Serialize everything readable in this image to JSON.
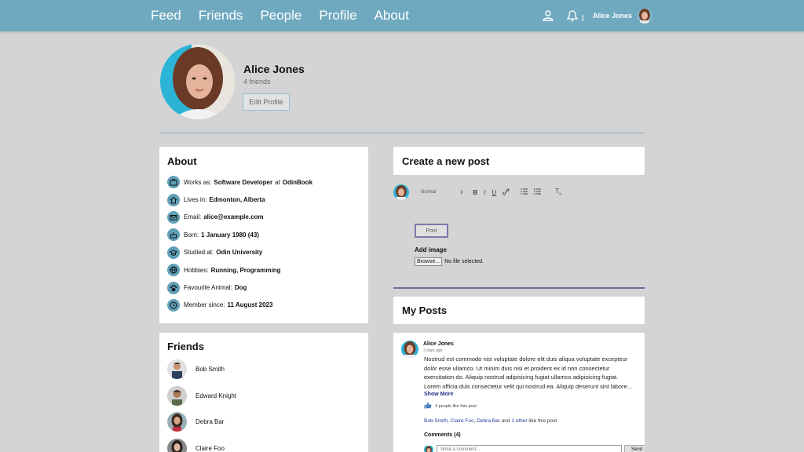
{
  "nav": {
    "links": [
      "Feed",
      "Friends",
      "People",
      "Profile",
      "About"
    ],
    "notification_count": "1",
    "user_name": "Alice Jones"
  },
  "profile": {
    "name": "Alice Jones",
    "friends_count": "4 friends",
    "edit_label": "Edit Profile"
  },
  "about": {
    "title": "About",
    "rows": [
      {
        "icon": "briefcase-icon",
        "label": "Works as:",
        "value": "Software Developer",
        "mid": "at",
        "value2": "OdinBook"
      },
      {
        "icon": "home-icon",
        "label": "Lives in:",
        "value": "Edmonton, Alberta"
      },
      {
        "icon": "email-icon",
        "label": "Email:",
        "value": "alice@example.com"
      },
      {
        "icon": "birthday-cake-icon",
        "label": "Born:",
        "value": "1 January 1980 (43)"
      },
      {
        "icon": "graduation-cap-icon",
        "label": "Studied at:",
        "value": "Odin University"
      },
      {
        "icon": "globe-icon",
        "label": "Hobbies:",
        "value": "Running, Programming"
      },
      {
        "icon": "paw-icon",
        "label": "Favourite Animal:",
        "value": "Dog"
      },
      {
        "icon": "clock-icon",
        "label": "Member since:",
        "value": "11 August 2023"
      }
    ]
  },
  "friends": {
    "title": "Friends",
    "items": [
      "Bob Smith",
      "Edward Knight",
      "Debra Bar",
      "Claire Foo"
    ]
  },
  "create_post": {
    "title": "Create a new post",
    "format_label": "Normal",
    "post_label": "Post",
    "add_image_label": "Add image",
    "browse_label": "Browse...",
    "file_status": "No file selected."
  },
  "my_posts": {
    "title": "My Posts",
    "post": {
      "author": "Alice Jones",
      "time": "2 days ago",
      "body": "Nostrud est commodo nisi voluptate dolore elit duis aliqua voluptate excepteur dolor esse ullamco. Ut minim duis nisi et proident ex id non consectetur exercitation do. Aliquip nostrud adipisicing fugiat ullamco adipisicing fugiat. Lorem officia duis consectetur velit qui nostrud ea. Aliquip deserunt sint labore...",
      "show_more": "Show More",
      "likes_text": "4 people like this post",
      "likers": [
        "Bob Smith",
        "Claire Foo",
        "Debra Bar"
      ],
      "likers_tail_and": "and",
      "likers_other": "1 other",
      "likers_tail": "like this post",
      "comments_label": "Comments (4)",
      "comment_placeholder": "Write a comment...",
      "send_label": "Send"
    }
  },
  "colors": {
    "nav_bg": "#6fa9bf",
    "page_bg": "#d4d4d4",
    "accent": "#5f9fb8",
    "link": "#2a3a9c"
  }
}
